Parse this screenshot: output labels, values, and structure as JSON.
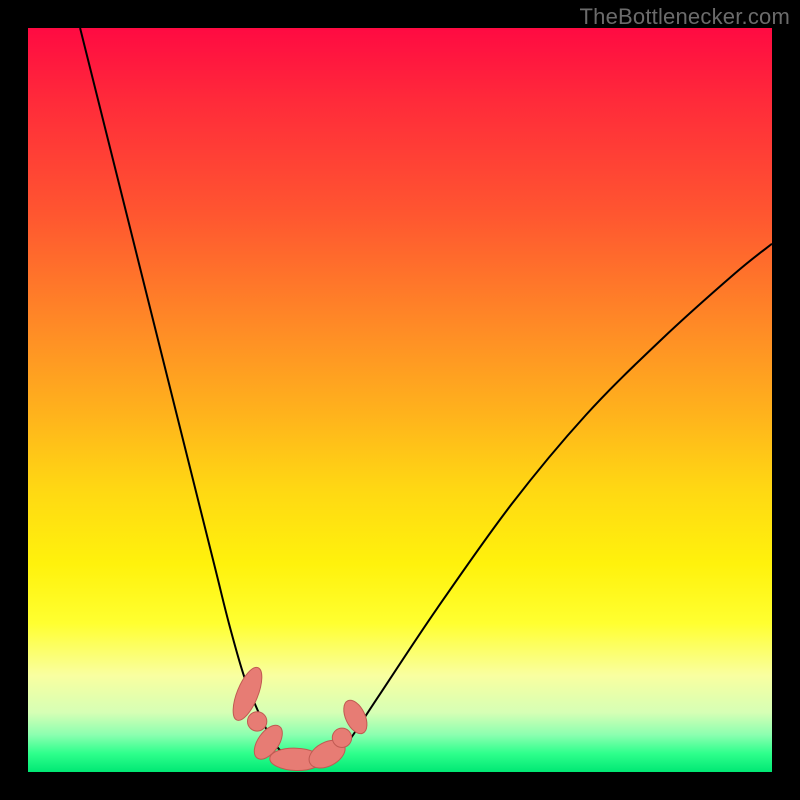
{
  "watermark": {
    "text": "TheBottlenecker.com"
  },
  "colors": {
    "frame": "#000000",
    "gradient_top": "#ff0a42",
    "gradient_bottom": "#00e874",
    "curve_stroke": "#000000",
    "marker_fill": "#e77c74",
    "marker_stroke": "#c05a52"
  },
  "chart_data": {
    "type": "line",
    "title": "",
    "xlabel": "",
    "ylabel": "",
    "xlim": [
      0,
      100
    ],
    "ylim": [
      0,
      100
    ],
    "x": [
      7,
      10,
      15,
      20,
      25,
      27,
      29,
      31,
      33,
      35,
      37,
      39,
      41,
      43,
      47,
      55,
      65,
      75,
      85,
      95,
      100
    ],
    "values": [
      100,
      88,
      68,
      48,
      28,
      20,
      13,
      8,
      4,
      2,
      1.5,
      1.5,
      2,
      4,
      10,
      22,
      36,
      48,
      58,
      67,
      71
    ],
    "series": [
      {
        "name": "bottleneck-curve",
        "x_ref": "x",
        "y_ref": "values"
      }
    ],
    "markers": [
      {
        "shape": "pill",
        "cx": 29.5,
        "cy": 10.5,
        "rx": 1.4,
        "ry": 3.8,
        "rot": 22
      },
      {
        "shape": "dot",
        "cx": 30.8,
        "cy": 6.8,
        "r": 1.3
      },
      {
        "shape": "pill",
        "cx": 32.3,
        "cy": 4.0,
        "rx": 1.4,
        "ry": 2.6,
        "rot": 35
      },
      {
        "shape": "pill",
        "cx": 36.0,
        "cy": 1.7,
        "rx": 3.5,
        "ry": 1.5,
        "rot": 2
      },
      {
        "shape": "pill",
        "cx": 40.2,
        "cy": 2.4,
        "rx": 2.6,
        "ry": 1.6,
        "rot": -28
      },
      {
        "shape": "dot",
        "cx": 42.2,
        "cy": 4.6,
        "r": 1.3
      },
      {
        "shape": "pill",
        "cx": 44.0,
        "cy": 7.4,
        "rx": 1.3,
        "ry": 2.4,
        "rot": -25
      }
    ],
    "annotations": []
  }
}
